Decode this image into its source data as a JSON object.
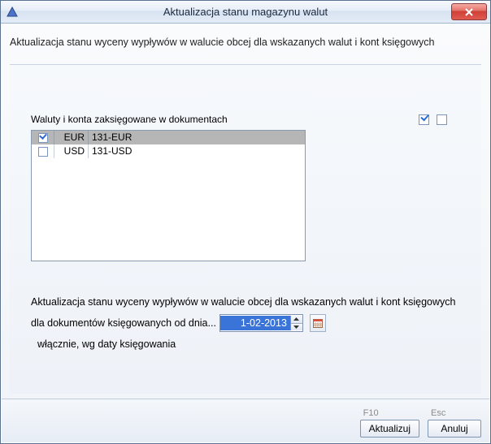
{
  "window": {
    "title": "Aktualizacja stanu magazynu walut"
  },
  "intro": "Aktualizacja stanu wyceny wypływów w walucie obcej dla wskazanych walut i kont księgowych",
  "table": {
    "caption": "Waluty i konta zaksięgowane w dokumentach",
    "rows": [
      {
        "checked": true,
        "currency": "EUR",
        "account": "131-EUR",
        "selected": true
      },
      {
        "checked": false,
        "currency": "USD",
        "account": "131-USD",
        "selected": false
      }
    ]
  },
  "lower": {
    "line1": "Aktualizacja stanu wyceny wypływów w walucie obcej dla wskazanych walut i kont księgowych",
    "prefix": "dla dokumentów księgowanych od dnia...",
    "date": "1-02-2013",
    "suffix": "włącznie, wg daty księgowania"
  },
  "buttons": {
    "ok_hint": "F10",
    "ok_label": "Aktualizuj",
    "cancel_hint": "Esc",
    "cancel_label": "Anuluj"
  }
}
